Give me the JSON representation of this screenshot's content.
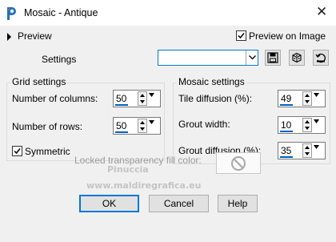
{
  "window": {
    "title": "Mosaic - Antique",
    "close_glyph": "✕"
  },
  "preview": {
    "label": "Preview",
    "preview_on_image_label": "Preview on Image",
    "preview_on_image_checked": true
  },
  "settings": {
    "label": "Settings",
    "combo_value": ""
  },
  "grid_settings": {
    "title": "Grid settings",
    "columns": {
      "label": "Number of columns:",
      "value": "50"
    },
    "rows": {
      "label": "Number of rows:",
      "value": "50"
    },
    "symmetric": {
      "label": "Symmetric",
      "checked": true
    }
  },
  "mosaic_settings": {
    "title": "Mosaic settings",
    "tile_diffusion": {
      "label": "Tile diffusion (%):",
      "value": "49"
    },
    "grout_width": {
      "label": "Grout width:",
      "value": "10"
    },
    "grout_diffusion": {
      "label": "Grout diffusion (%):",
      "value": "35"
    }
  },
  "locked_transparency": {
    "label": "Locked transparency fill color:"
  },
  "watermark": {
    "line1": "Pinuccia",
    "line2": "www.maldiregrafica.eu"
  },
  "buttons": {
    "ok": "OK",
    "cancel": "Cancel",
    "help": "Help"
  },
  "colors": {
    "accent": "#0078d7",
    "dialog_bg": "#f0f0f0"
  }
}
